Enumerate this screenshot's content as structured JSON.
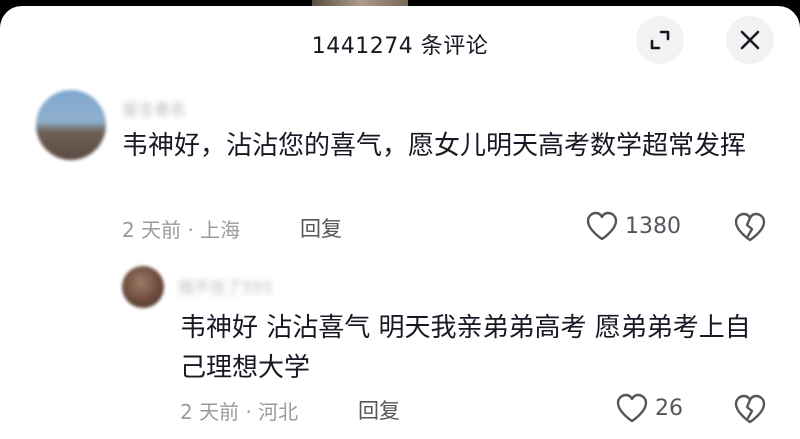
{
  "header": {
    "title": "1441274 条评论"
  },
  "comments": [
    {
      "username": "留言者名",
      "text": "韦神好，沾沾您的喜气，愿女儿明天高考数学超常发挥",
      "meta": "2 天前 · 上海",
      "reply_label": "回复",
      "likes": "1380"
    },
    {
      "username": "我不在了555",
      "text": "韦神好 沾沾喜气 明天我亲弟弟高考 愿弟弟考上自己理想大学",
      "meta": "2 天前 · 河北",
      "reply_label": "回复",
      "likes": "26"
    }
  ],
  "icons": {
    "expand": "expand-icon",
    "close": "close-icon",
    "like": "heart-icon",
    "dislike": "broken-heart-icon"
  }
}
